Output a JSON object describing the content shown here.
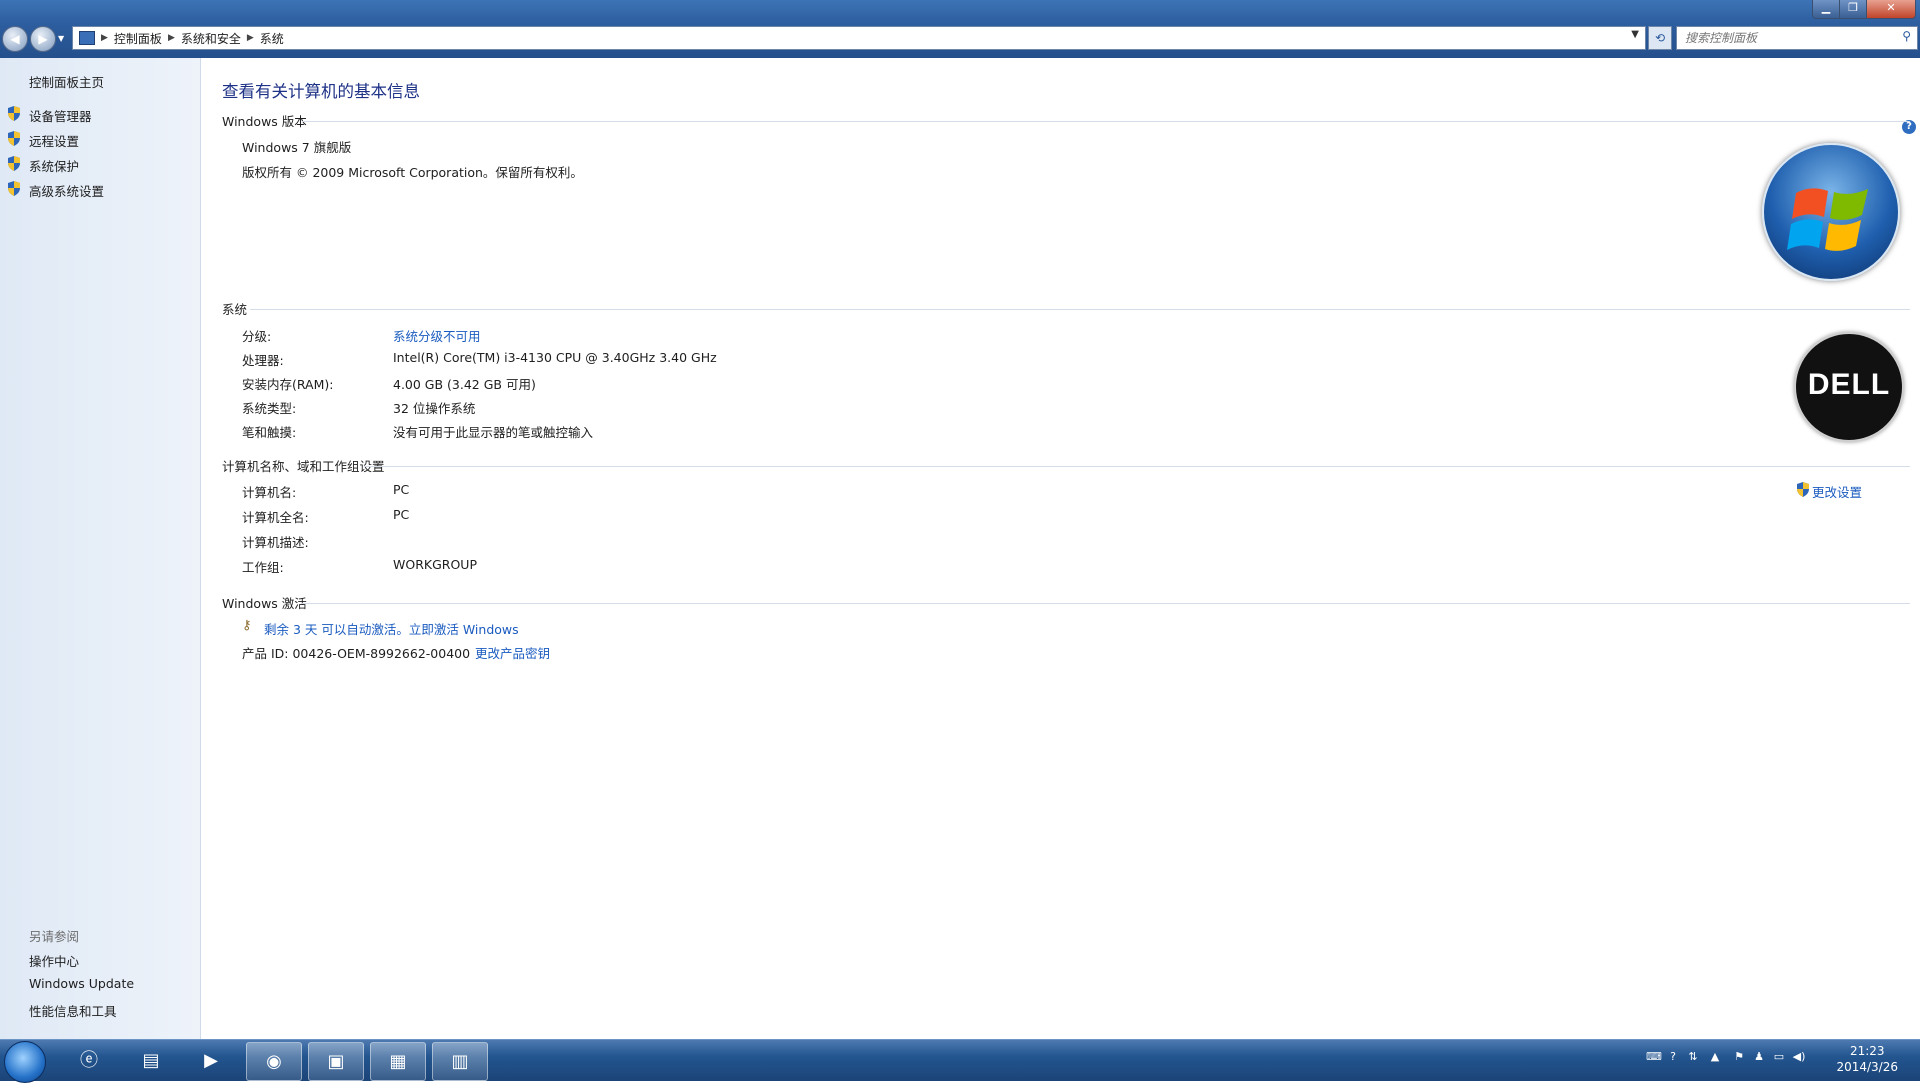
{
  "address_bar": {
    "breadcrumbs": [
      "控制面板",
      "系统和安全",
      "系统"
    ],
    "search_placeholder": "搜索控制面板"
  },
  "left_pane": {
    "home": "控制面板主页",
    "tasks": [
      "设备管理器",
      "远程设置",
      "系统保护",
      "高级系统设置"
    ],
    "see_also_title": "另请参阅",
    "see_also": [
      "操作中心",
      "Windows Update",
      "性能信息和工具"
    ]
  },
  "content": {
    "title": "查看有关计算机的基本信息",
    "windows_edition": {
      "header": "Windows 版本",
      "name": "Windows 7 旗舰版",
      "copyright": "版权所有 © 2009 Microsoft Corporation。保留所有权利。"
    },
    "system": {
      "header": "系统",
      "rows": [
        {
          "label": "分级:",
          "value": "系统分级不可用"
        },
        {
          "label": "处理器:",
          "value": "Intel(R) Core(TM) i3-4130 CPU @ 3.40GHz   3.40 GHz"
        },
        {
          "label": "安装内存(RAM):",
          "value": "4.00 GB (3.42 GB 可用)"
        },
        {
          "label": "系统类型:",
          "value": "32 位操作系统"
        },
        {
          "label": "笔和触摸:",
          "value": "没有可用于此显示器的笔或触控输入"
        }
      ]
    },
    "computer_name": {
      "header": "计算机名称、域和工作组设置",
      "change_settings": "更改设置",
      "rows": [
        {
          "label": "计算机名:",
          "value": "PC"
        },
        {
          "label": "计算机全名:",
          "value": "PC"
        },
        {
          "label": "计算机描述:",
          "value": ""
        },
        {
          "label": "工作组:",
          "value": "WORKGROUP"
        }
      ]
    },
    "activation": {
      "header": "Windows 激活",
      "status_link": "剩余 3 天 可以自动激活。立即激活 Windows",
      "product_id": "产品 ID: 00426-OEM-8992662-00400",
      "change_key": "更改产品密钥"
    },
    "oem_logo_text": "DELL"
  },
  "taskbar": {
    "clock_time": "21:23",
    "clock_date": "2014/3/26"
  }
}
